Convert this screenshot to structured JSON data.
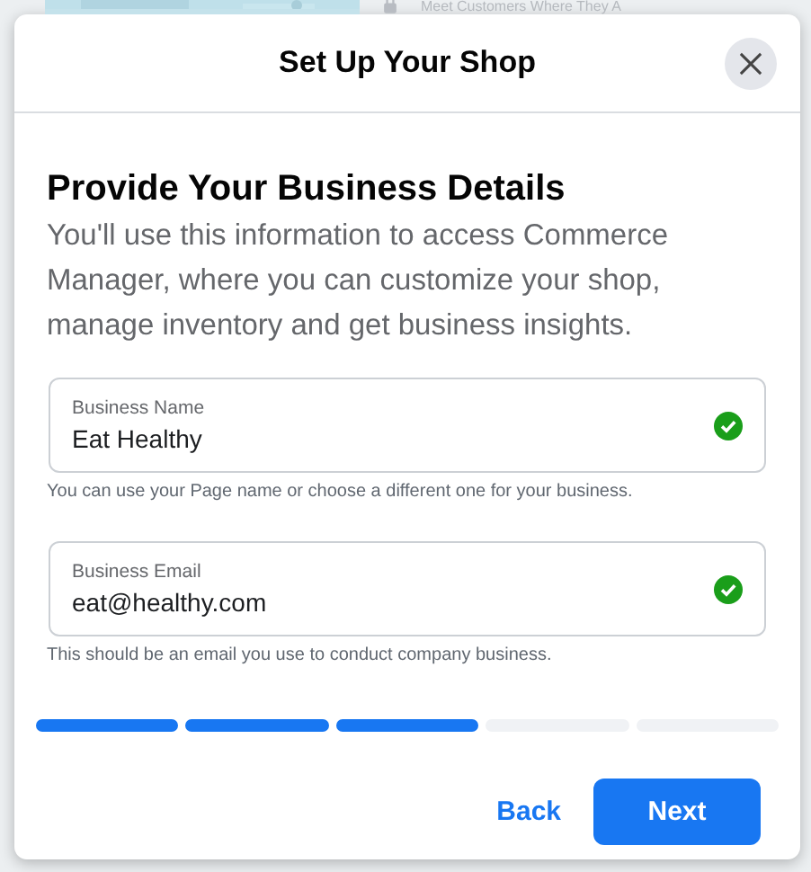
{
  "background": {
    "heading": "Meet Customers Where They A"
  },
  "dialog": {
    "title": "Set Up Your Shop",
    "heading": "Provide Your Business Details",
    "description": "You'll use this information to access Commerce Manager, where you can customize your shop, manage inventory and get business insights.",
    "fields": [
      {
        "label": "Business Name",
        "value": "Eat Healthy",
        "valid": true,
        "help": "You can use your Page name or choose a different one for your business."
      },
      {
        "label": "Business Email",
        "value": "eat@healthy.com",
        "valid": true,
        "help": "This should be an email you use to conduct company business."
      }
    ],
    "steps": [
      {
        "done": true
      },
      {
        "done": true
      },
      {
        "done": true
      },
      {
        "done": false
      },
      {
        "done": false
      }
    ],
    "buttons": {
      "back": "Back",
      "next": "Next"
    }
  }
}
